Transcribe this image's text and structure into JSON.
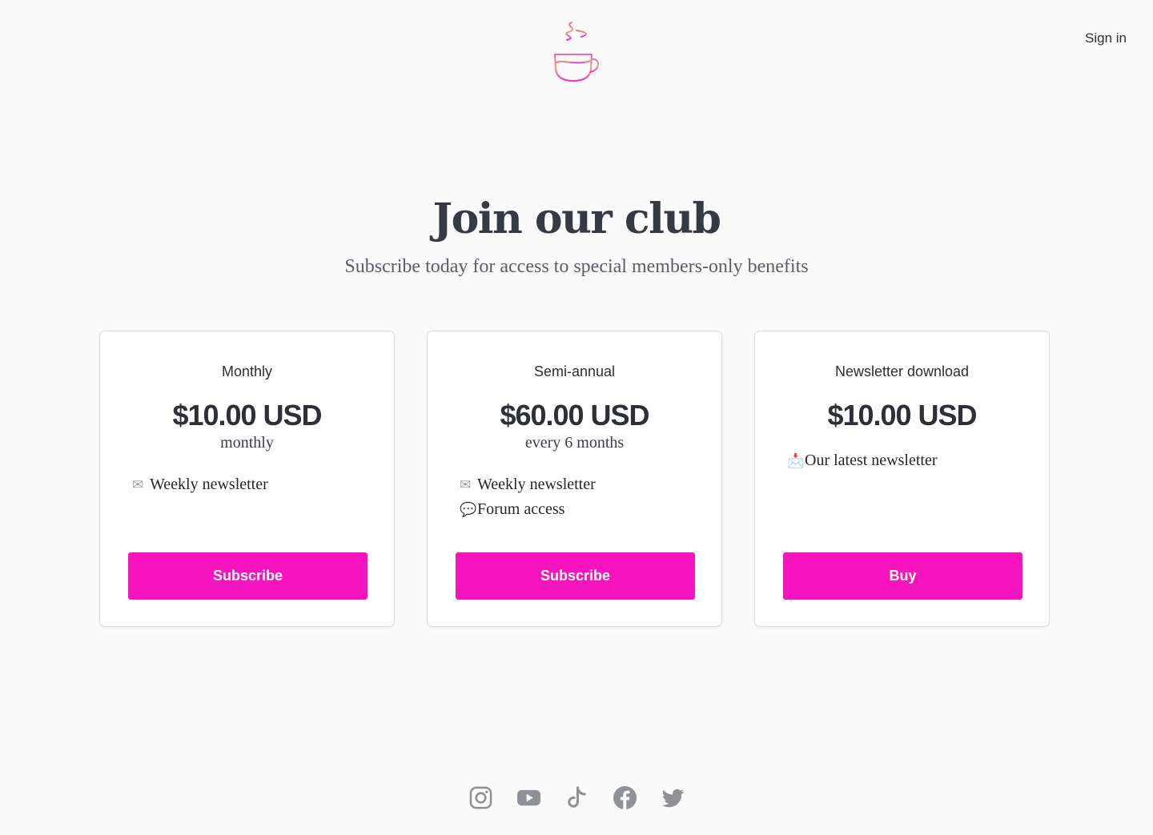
{
  "header": {
    "signin_label": "Sign in"
  },
  "hero": {
    "title": "Join our club",
    "subtitle": "Subscribe today for access to special members-only benefits"
  },
  "plans": [
    {
      "title": "Monthly",
      "price": "$10.00 USD",
      "period": "monthly",
      "features": [
        {
          "icon": "envelope-icon",
          "glyph": "✉",
          "text": "Weekly newsletter"
        }
      ],
      "button_label": "Subscribe"
    },
    {
      "title": "Semi-annual",
      "price": "$60.00 USD",
      "period": "every 6 months",
      "features": [
        {
          "icon": "envelope-icon",
          "glyph": "✉",
          "text": "Weekly newsletter"
        },
        {
          "icon": "speech-bubble-icon",
          "glyph": "💬",
          "text": "Forum access"
        }
      ],
      "button_label": "Subscribe"
    },
    {
      "title": "Newsletter download",
      "price": "$10.00 USD",
      "features": [
        {
          "icon": "envelope-with-arrow-icon",
          "glyph": "📩",
          "text": "Our latest newsletter"
        }
      ],
      "button_label": "Buy"
    }
  ],
  "social": [
    "instagram-icon",
    "youtube-icon",
    "tiktok-icon",
    "facebook-icon",
    "twitter-icon"
  ],
  "colors": {
    "accent": "#f714be",
    "background": "#fafafa",
    "text": "#353a43",
    "social_icon": "#8e9196"
  }
}
